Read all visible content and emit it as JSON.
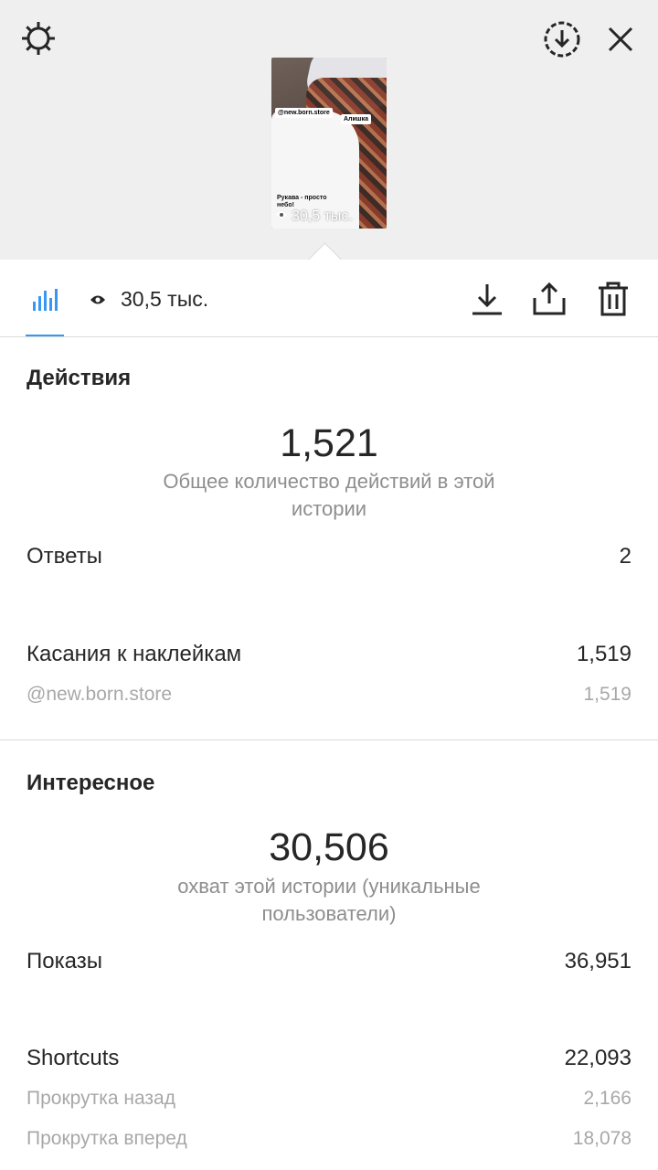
{
  "story": {
    "sticker_mention": "@new.born.store",
    "sticker_name": "Алишка",
    "caption": "Рукава - просто небо!",
    "views_overlay": "30,5 тыс."
  },
  "toolbar": {
    "views": "30,5 тыс."
  },
  "icons": {
    "settings": "gear-icon",
    "save_story": "circle-download-icon",
    "close": "close-icon",
    "insights_tab": "bar-chart-icon",
    "views": "eye-icon",
    "download": "download-icon",
    "share": "share-icon",
    "delete": "trash-icon"
  },
  "colors": {
    "accent": "#3897f0",
    "primary_text": "#262626",
    "secondary_text": "#8e8e8e",
    "top_background": "#efefef"
  },
  "actions": {
    "title": "Действия",
    "total": "1,521",
    "total_caption": "Общее количество действий в этой истории",
    "replies_label": "Ответы",
    "replies_value": "2",
    "sticker_taps_label": "Касания к наклейкам",
    "sticker_taps_value": "1,519",
    "sticker_account": "@new.born.store",
    "sticker_account_value": "1,519"
  },
  "discovery": {
    "title": "Интересное",
    "reach": "30,506",
    "reach_caption": "охват этой истории (уникальные пользователи)",
    "impressions_label": "Показы",
    "impressions_value": "36,951",
    "shortcuts_label": "Shortcuts",
    "shortcuts_value": "22,093",
    "back_label": "Прокрутка назад",
    "back_value": "2,166",
    "forward_label": "Прокрутка вперед",
    "forward_value": "18,078"
  }
}
